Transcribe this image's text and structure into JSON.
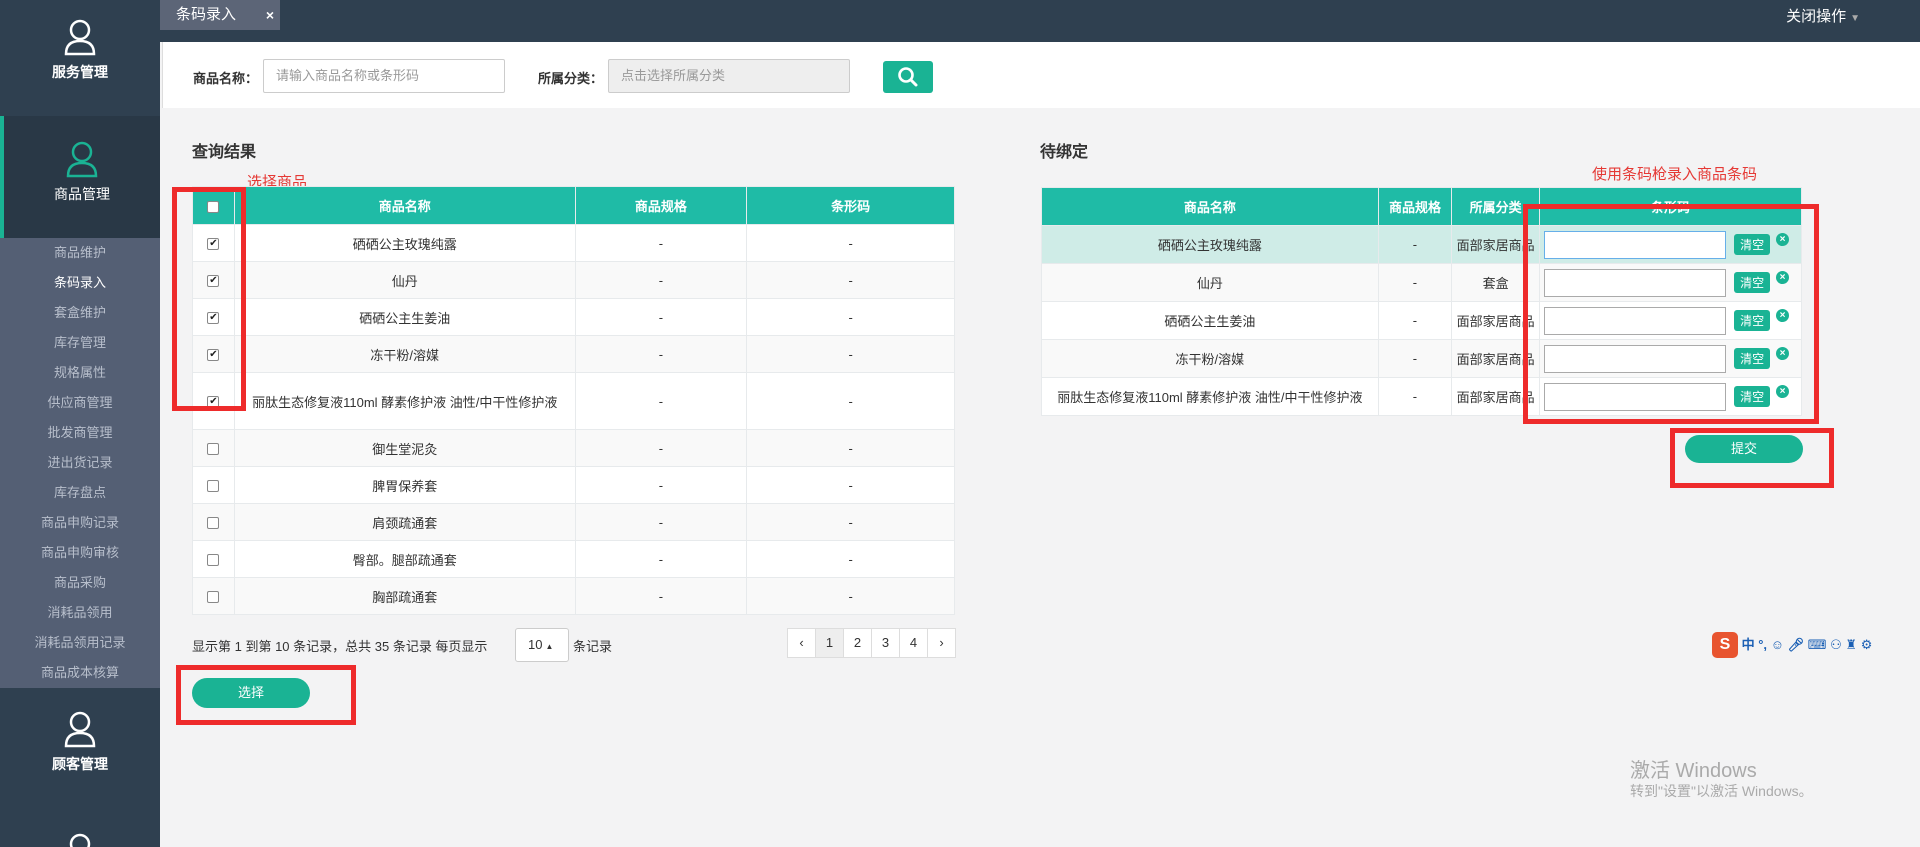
{
  "sidebar": {
    "service": "服务管理",
    "goods": "商品管理",
    "customer": "顾客管理",
    "submenu": [
      "商品维护",
      "条码录入",
      "套盒维护",
      "库存管理",
      "规格属性",
      "供应商管理",
      "批发商管理",
      "进出货记录",
      "库存盘点",
      "商品申购记录",
      "商品申购审核",
      "商品采购",
      "消耗品领用",
      "消耗品领用记录",
      "商品成本核算"
    ],
    "active_index": 1
  },
  "topbar": {
    "tab_label": "条码录入",
    "tab_close": "×",
    "close_ops": "关闭操作"
  },
  "search": {
    "name_label": "商品名称：",
    "name_placeholder": "请输入商品名称或条形码",
    "category_label": "所属分类：",
    "category_placeholder": "点击选择所属分类"
  },
  "left": {
    "title": "查询结果",
    "annotation": "选择商品",
    "columns": [
      "商品名称",
      "商品规格",
      "条形码"
    ],
    "rows": [
      {
        "name": "硒硒公主玫瑰纯露",
        "spec": "-",
        "barcode": "-",
        "checked": true
      },
      {
        "name": "仙丹",
        "spec": "-",
        "barcode": "-",
        "checked": true
      },
      {
        "name": "硒硒公主生姜油",
        "spec": "-",
        "barcode": "-",
        "checked": true
      },
      {
        "name": "冻干粉/溶媒",
        "spec": "-",
        "barcode": "-",
        "checked": true
      },
      {
        "name": "丽肽生态修复液110ml 酵素修护液 油性/中干性修护液",
        "spec": "-",
        "barcode": "-",
        "checked": true
      },
      {
        "name": "御生堂泥灸",
        "spec": "-",
        "barcode": "-",
        "checked": false
      },
      {
        "name": "脾胃保养套",
        "spec": "-",
        "barcode": "-",
        "checked": false
      },
      {
        "name": "肩颈疏通套",
        "spec": "-",
        "barcode": "-",
        "checked": false
      },
      {
        "name": "臀部。腿部疏通套",
        "spec": "-",
        "barcode": "-",
        "checked": false
      },
      {
        "name": "胸部疏通套",
        "spec": "-",
        "barcode": "-",
        "checked": false
      }
    ],
    "page_info": "显示第 1 到第 10 条记录，总共 35 条记录 每页显示",
    "page_size": "10",
    "page_suffix": "条记录",
    "pages": [
      "‹",
      "1",
      "2",
      "3",
      "4",
      "›"
    ],
    "select_button": "选择"
  },
  "right": {
    "title": "待绑定",
    "annotation": "使用条码枪录入商品条码",
    "columns": [
      "商品名称",
      "商品规格",
      "所属分类",
      "条形码"
    ],
    "rows": [
      {
        "name": "硒硒公主玫瑰纯露",
        "spec": "-",
        "category": "面部家居商品"
      },
      {
        "name": "仙丹",
        "spec": "-",
        "category": "套盒"
      },
      {
        "name": "硒硒公主生姜油",
        "spec": "-",
        "category": "面部家居商品"
      },
      {
        "name": "冻干粉/溶媒",
        "spec": "-",
        "category": "面部家居商品"
      },
      {
        "name": "丽肽生态修复液110ml 酵素修护液 油性/中干性修护液",
        "spec": "-",
        "category": "面部家居商品"
      }
    ],
    "clear_label": "清空",
    "submit_button": "提交"
  },
  "watermark": {
    "line1": "激活 Windows",
    "line2": "转到\"设置\"以激活 Windows。"
  },
  "ime": {
    "logo": "S",
    "text": "中 °,"
  },
  "colors": {
    "accent": "#1ab394",
    "sidebar": "#2f4050",
    "annotation_red": "#ee2b2b"
  }
}
